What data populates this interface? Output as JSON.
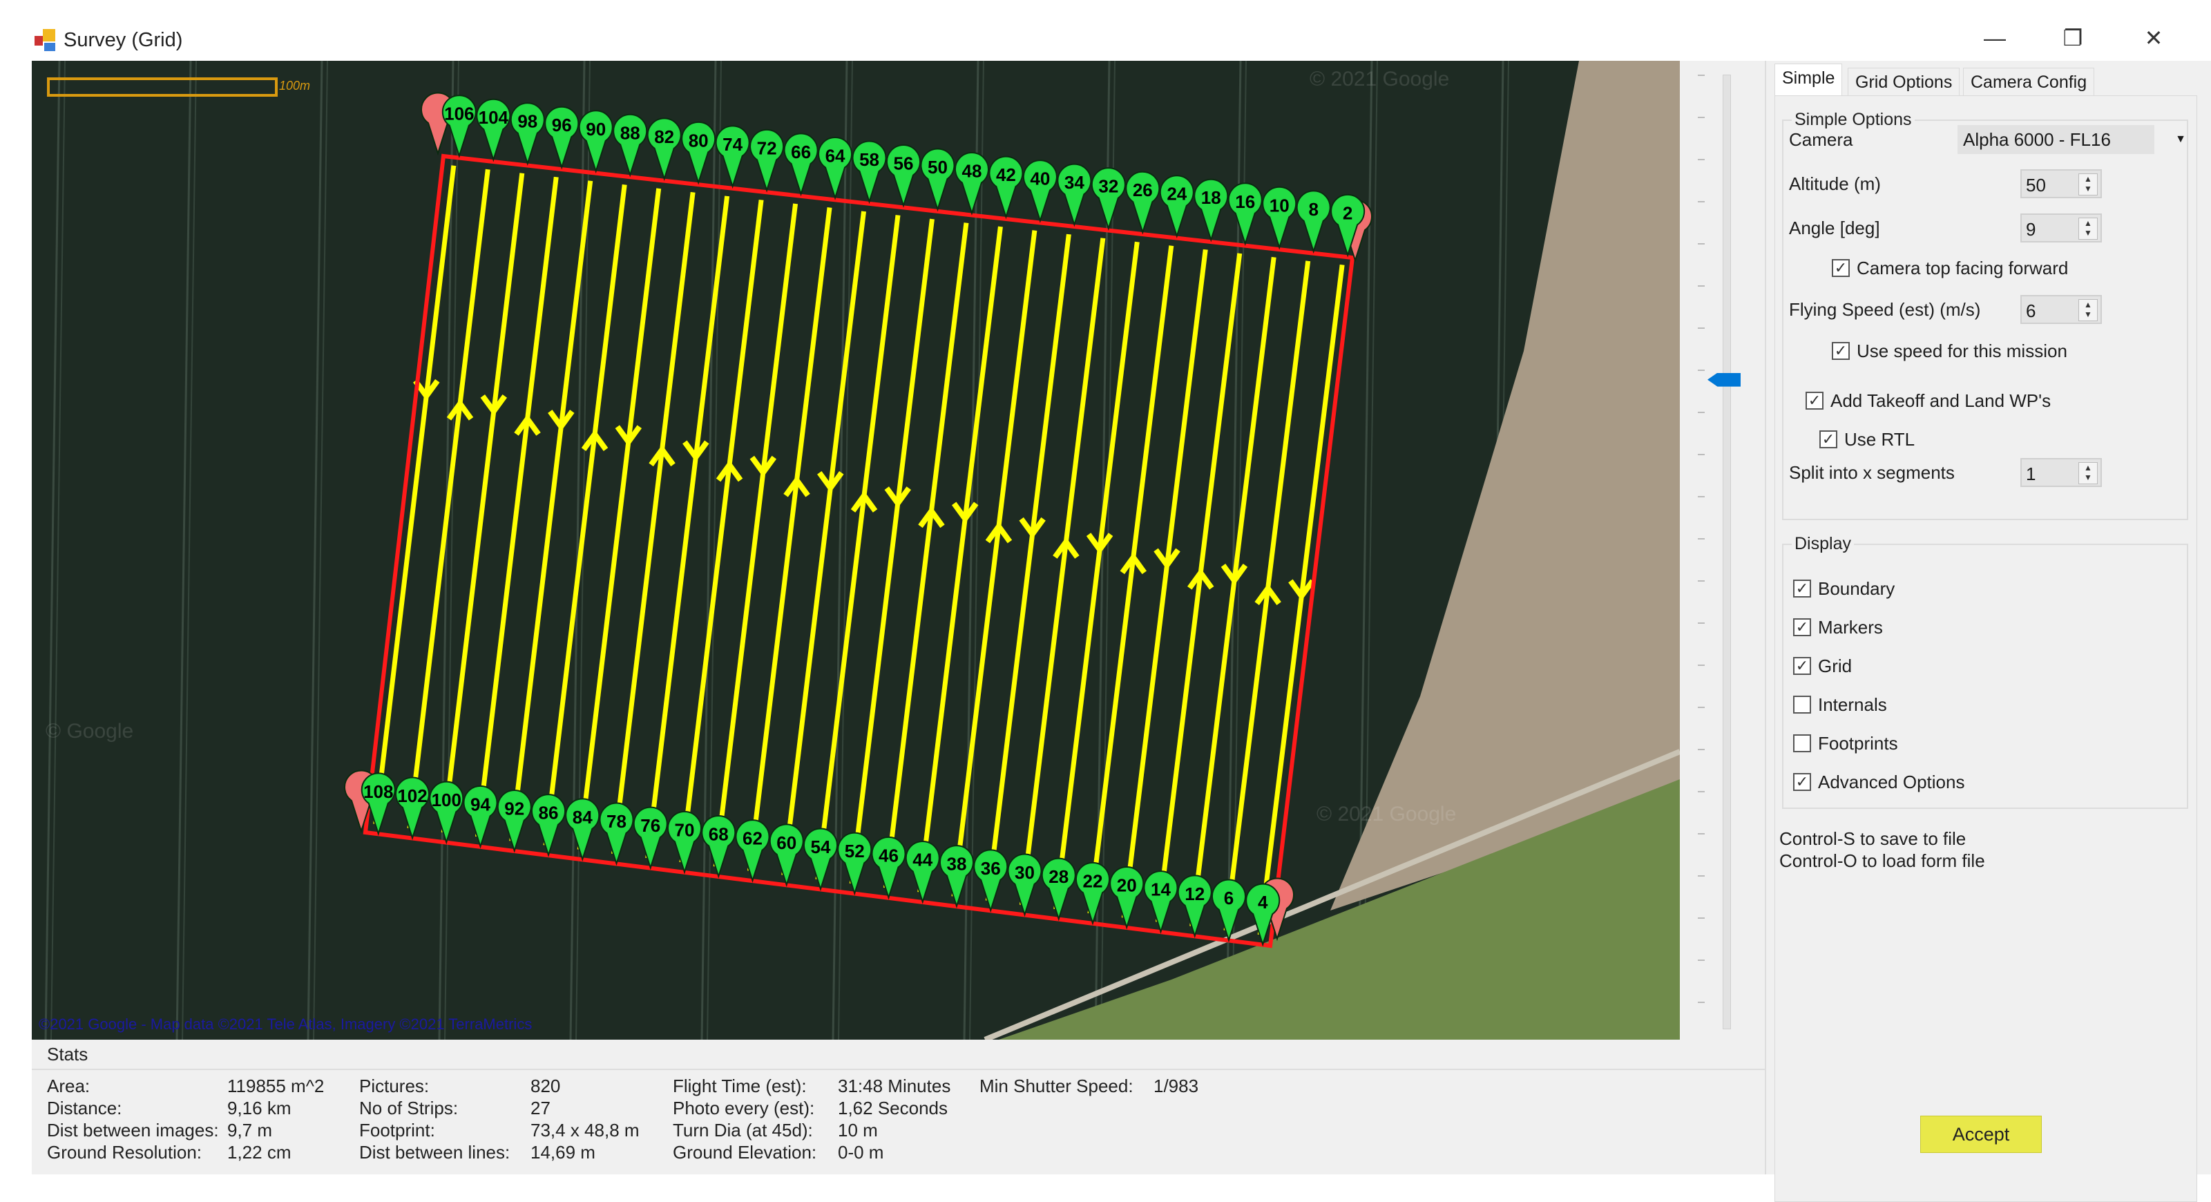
{
  "window": {
    "title": "Survey (Grid)",
    "controls": {
      "minimize": "—",
      "restore": "❐",
      "close": "✕"
    }
  },
  "map": {
    "scale_label": "100m",
    "attribution": "©2021 Google - Map data ©2021 Tele Atlas, Imagery ©2021 TerraMetrics",
    "watermarks": [
      "© 2021 Google",
      "© Google",
      "© 2021 Google"
    ],
    "top_markers": [
      "106",
      "104",
      "98",
      "96",
      "90",
      "88",
      "82",
      "80",
      "74",
      "72",
      "66",
      "64",
      "58",
      "56",
      "50",
      "48",
      "42",
      "40",
      "34",
      "32",
      "26",
      "24",
      "18",
      "16",
      "10",
      "8",
      "2"
    ],
    "bottom_markers": [
      "108",
      "102",
      "100",
      "94",
      "92",
      "86",
      "84",
      "78",
      "76",
      "70",
      "68",
      "62",
      "60",
      "54",
      "52",
      "46",
      "44",
      "38",
      "36",
      "30",
      "28",
      "22",
      "20",
      "14",
      "12",
      "6",
      "4"
    ],
    "colors": {
      "boundary": "#ff1a1a",
      "grid": "#ffff00",
      "marker": "#22dd44",
      "endpoint": "#f07070"
    }
  },
  "zoom_slider": {
    "position_fraction": 0.32
  },
  "tabs": [
    {
      "label": "Simple"
    },
    {
      "label": "Grid Options"
    },
    {
      "label": "Camera Config"
    }
  ],
  "simple_options": {
    "group_label": "Simple Options",
    "camera_label": "Camera",
    "camera_value": "Alpha 6000 - FL16",
    "altitude_label": "Altitude (m)",
    "altitude_value": "50",
    "angle_label": "Angle [deg]",
    "angle_value": "9",
    "camera_top_forward": {
      "label": "Camera top facing forward",
      "checked": true
    },
    "speed_label": "Flying Speed (est) (m/s)",
    "speed_value": "6",
    "use_speed": {
      "label": "Use speed for this mission",
      "checked": true
    },
    "takeoff_land": {
      "label": "Add Takeoff and Land WP's",
      "checked": true
    },
    "use_rtl": {
      "label": "Use RTL",
      "checked": true
    },
    "split_label": "Split into x segments",
    "split_value": "1"
  },
  "display": {
    "group_label": "Display",
    "items": [
      {
        "label": "Boundary",
        "checked": true
      },
      {
        "label": "Markers",
        "checked": true
      },
      {
        "label": "Grid",
        "checked": true
      },
      {
        "label": "Internals",
        "checked": false
      },
      {
        "label": "Footprints",
        "checked": false
      },
      {
        "label": "Advanced Options",
        "checked": true
      }
    ]
  },
  "hints": [
    "Control-S to save to file",
    "Control-O to load form file"
  ],
  "stats": {
    "title": "Stats",
    "col1": [
      [
        "Area:",
        "119855 m^2"
      ],
      [
        "Distance:",
        "9,16 km"
      ],
      [
        "Dist between images:",
        "9,7 m"
      ],
      [
        "Ground Resolution:",
        "1,22 cm"
      ]
    ],
    "col2": [
      [
        "Pictures:",
        "820"
      ],
      [
        "No of Strips:",
        "27"
      ],
      [
        "Footprint:",
        "73,4 x 48,8 m"
      ],
      [
        "Dist between lines:",
        "14,69 m"
      ]
    ],
    "col3": [
      [
        "Flight Time (est):",
        "31:48 Minutes"
      ],
      [
        "Photo every (est):",
        "1,62 Seconds"
      ],
      [
        "Turn Dia (at 45d):",
        "10 m"
      ],
      [
        "Ground Elevation:",
        "0-0 m"
      ]
    ],
    "shutter_label": "Min Shutter Speed:",
    "shutter_value": "1/983"
  },
  "accept_label": "Accept"
}
